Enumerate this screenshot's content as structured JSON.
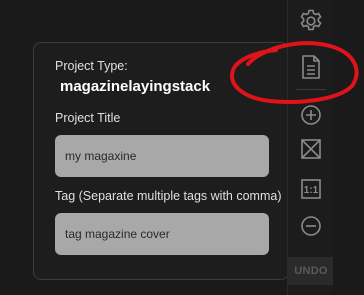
{
  "panel": {
    "project_type_label": "Project Type:",
    "project_type_value": "magazinelayingstack",
    "project_title_label": "Project Title",
    "project_title_value": "my magaxine",
    "tag_label": "Tag (Separate multiple tags with comma)",
    "tag_value": "tag magazine cover"
  },
  "toolbar": {
    "tools": [
      "gear-icon",
      "document-icon",
      "zoom-in-icon",
      "fit-screen-icon",
      "actual-size-icon",
      "zoom-out-icon"
    ],
    "actual_size_label": "1:1",
    "undo_label": "UNDO"
  },
  "colors": {
    "annotation": "#e0131b",
    "field_bg": "#a8a8a8",
    "panel_bg": "#1d1d1d"
  }
}
